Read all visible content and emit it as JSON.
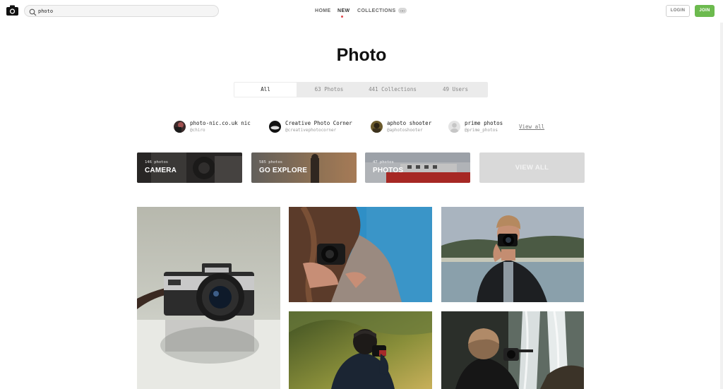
{
  "header": {
    "search": {
      "value": "photo",
      "placeholder": ""
    },
    "nav": [
      {
        "label": "HOME",
        "active": false
      },
      {
        "label": "NEW",
        "active": true
      },
      {
        "label": "COLLECTIONS",
        "active": false
      }
    ],
    "login_label": "LOGIN",
    "join_label": "JOIN"
  },
  "page": {
    "title": "Photo"
  },
  "tabs": [
    {
      "label": "All",
      "active": true
    },
    {
      "label": "63 Photos",
      "active": false
    },
    {
      "label": "441 Collections",
      "active": false
    },
    {
      "label": "49 Users",
      "active": false
    }
  ],
  "users": [
    {
      "name": "photo-nic.co.uk nic",
      "handle": "@chiro"
    },
    {
      "name": "Creative Photo Corner",
      "handle": "@creativephotocorner"
    },
    {
      "name": "aphoto shooter",
      "handle": "@aphotoshooter"
    },
    {
      "name": "prime photos",
      "handle": "@prime_photos"
    }
  ],
  "users_view_all": "View all",
  "collections": [
    {
      "count": "146 photos",
      "label": "CAMERA"
    },
    {
      "count": "585 photos",
      "label": "GO EXPLORE"
    },
    {
      "count": "47 photos",
      "label": "PHOTOS"
    }
  ],
  "collections_view_all": "VIEW ALL",
  "colors": {
    "join_button": "#6cba4e",
    "active_nav_dot": "#e0474c",
    "tab_bar": "#ebebeb"
  },
  "icons": {
    "logo": "camera-icon",
    "search": "search-icon",
    "more": "more-icon"
  }
}
